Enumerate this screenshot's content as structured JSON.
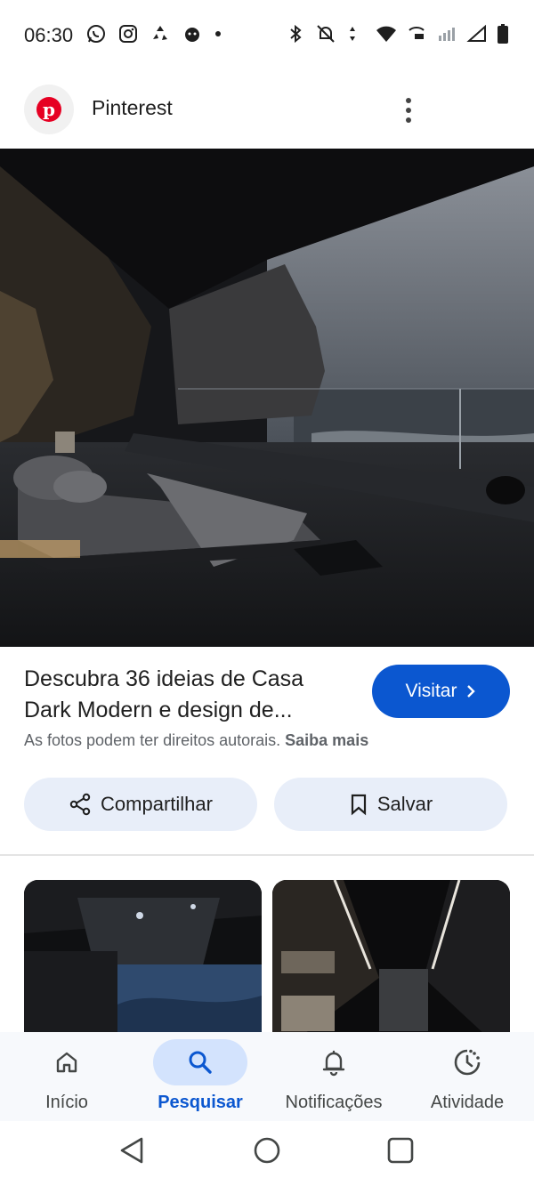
{
  "status_bar": {
    "time": "06:30",
    "left_icons": [
      "whatsapp-icon",
      "instagram-icon",
      "recycle-icon",
      "pet-icon",
      "dot-icon"
    ],
    "right_icons": [
      "bluetooth-icon",
      "bell-muted-icon",
      "data-arrows-icon",
      "wifi-icon",
      "volte-icon",
      "signal-icon",
      "signal-empty-icon",
      "battery-icon"
    ]
  },
  "header": {
    "app_name": "Pinterest",
    "logo_letter": "p"
  },
  "result": {
    "title": "Descubra 36 ideias de Casa Dark Modern e design de...",
    "visit_label": "Visitar",
    "copyright_text": "As fotos podem ter direitos autorais.",
    "learn_more": "Saiba mais",
    "share_label": "Compartilhar",
    "save_label": "Salvar"
  },
  "bottom_nav": {
    "items": [
      {
        "label": "Início",
        "icon": "home-icon"
      },
      {
        "label": "Pesquisar",
        "icon": "search-icon",
        "active": true
      },
      {
        "label": "Notificações",
        "icon": "bell-icon"
      },
      {
        "label": "Atividade",
        "icon": "activity-icon"
      }
    ]
  },
  "colors": {
    "accent": "#0b57d0",
    "pinterest_red": "#e60023",
    "chip_bg": "#e8eef9",
    "nav_active_bg": "#d3e3fd"
  }
}
